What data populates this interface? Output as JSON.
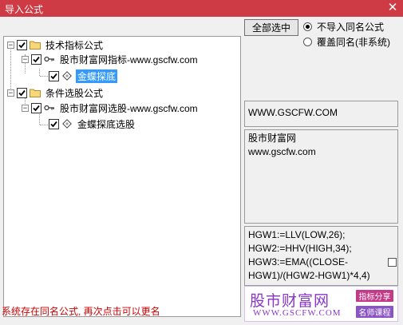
{
  "window": {
    "title": "导入公式",
    "close_glyph": "✕"
  },
  "tree": {
    "nodes": [
      {
        "label": "技术指标公式",
        "expander": "−"
      },
      {
        "label": "股市财富网指标-www.gscfw.com",
        "expander": "−"
      },
      {
        "label": "金蝶探底"
      },
      {
        "label": "条件选股公式",
        "expander": "−"
      },
      {
        "label": "股市财富网选股-www.gscfw.com",
        "expander": "−"
      },
      {
        "label": "金蝶探底选股"
      }
    ]
  },
  "controls": {
    "select_all": "全部选中",
    "radio_skip": "不导入同名公式",
    "radio_overwrite": "覆盖同名(非系统)"
  },
  "info": {
    "website": "WWW.GSCFW.COM",
    "description": "股市财富网\nwww.gscfw.com",
    "formula": "HGW1:=LLV(LOW,26);\nHGW2:=HHV(HIGH,34);\nHGW3:=EMA((CLOSE-\nHGW1)/(HGW2-HGW1)*4,4)"
  },
  "status": {
    "message": "系统存在同名公式, 再次点击可以更名"
  },
  "watermark": {
    "name": "股市财富网",
    "url": "WWW.GSCFW.COM",
    "tag1": "指标分享",
    "tag2": "名师课程"
  },
  "colors": {
    "titlebar": "#cf3b44",
    "selection": "#3399ff",
    "status": "#cc0000",
    "watermark": "#8b36c8"
  }
}
